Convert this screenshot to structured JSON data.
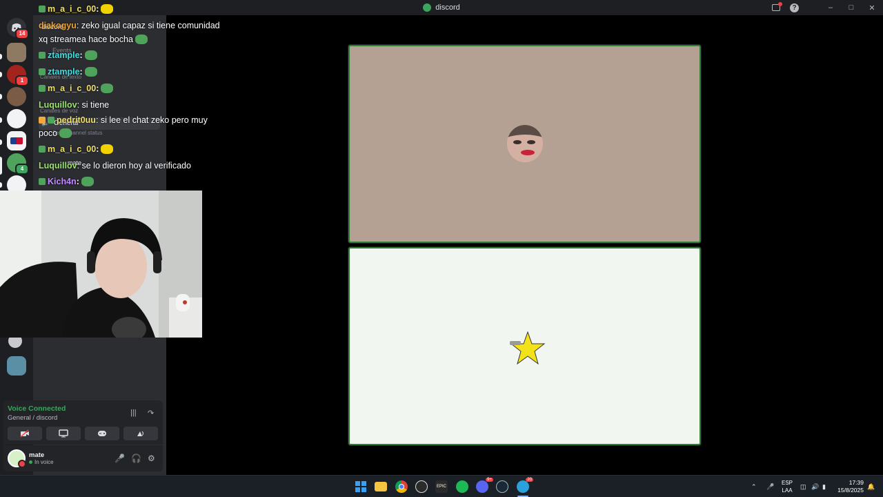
{
  "window": {
    "title": "discord",
    "icon": "frog-app-icon"
  },
  "titlebar_controls": [
    "inbox-icon",
    "help-icon",
    "minimize-icon",
    "maximize-icon",
    "close-icon"
  ],
  "guilds": [
    {
      "icon": "discord-home-icon",
      "badge": "14"
    },
    {
      "icon": "server-icon",
      "badge": ""
    },
    {
      "icon": "server-icon",
      "badge": "1"
    },
    {
      "icon": "server-icon",
      "badge": ""
    },
    {
      "icon": "server-icon",
      "badge": ""
    },
    {
      "icon": "server-icon",
      "badge": ""
    },
    {
      "icon": "server-icon",
      "badge": "4"
    },
    {
      "icon": "server-icon",
      "badge": ""
    }
  ],
  "channel_pane": {
    "server_name": "discord",
    "events_label": "Events",
    "text_header": "Canales de texto",
    "voice_header": "Canales de voz",
    "voice_channel": "General",
    "channel_status": "Set a channel status",
    "voice_member": "mate"
  },
  "chat": [
    {
      "user": "m_a_i_c_00",
      "color": "#f0e06a",
      "text": ""
    },
    {
      "user": "diakogyu",
      "color": "#e8a23a",
      "text": ": zeko igual capaz si tiene comunidad"
    },
    {
      "user": "",
      "color": "#ffffff",
      "text": "xq streamea hace bocha"
    },
    {
      "user": "ztample",
      "color": "#3be2e2",
      "text": ""
    },
    {
      "user": "ztample",
      "color": "#3be2e2",
      "text": ""
    },
    {
      "user": "m_a_i_c_00",
      "color": "#f0e06a",
      "text": ""
    },
    {
      "user": "Luquillov",
      "color": "#9ae36a",
      "text": ": si tiene"
    },
    {
      "user": "pedrit0uu",
      "color": "#f0e06a",
      "text": ": si lee el chat zeko pero muy"
    },
    {
      "user": "",
      "color": "#ffffff",
      "text": "poco"
    },
    {
      "user": "m_a_i_c_00",
      "color": "#f0e06a",
      "text": ""
    },
    {
      "user": "Luquillov",
      "color": "#9ae36a",
      "text": ": se lo dieron hoy al verificado"
    },
    {
      "user": "Kich4n",
      "color": "#c08cff",
      "text": ""
    }
  ],
  "voice_panel": {
    "title": "Voice Connected",
    "subtitle": "General / discord",
    "buttons": [
      "camera-off-icon",
      "screen-share-icon",
      "activity-gamepad-icon",
      "soundboard-icon"
    ]
  },
  "user_panel": {
    "username": "mate",
    "status": "In voice"
  },
  "tiles": [
    {
      "name": "participant-1",
      "bg": "#b5a194"
    },
    {
      "name": "participant-2",
      "bg": "#f2f6f0"
    }
  ],
  "taskbar": {
    "apps": [
      "windows-start-icon",
      "file-explorer-icon",
      "chrome-icon",
      "obs-icon",
      "epic-games-icon",
      "spotify-icon",
      "discord-icon",
      "steam-icon",
      "telegram-icon"
    ],
    "discord_badge": "9+",
    "telegram_badge": "20",
    "lang_top": "ESP",
    "lang_bottom": "LAA",
    "time": "17:39",
    "date": "15/8/2025"
  },
  "colors": {
    "accent_green": "#3ba55d",
    "tile_border": "#2f7d32",
    "danger": "#f23f43"
  }
}
